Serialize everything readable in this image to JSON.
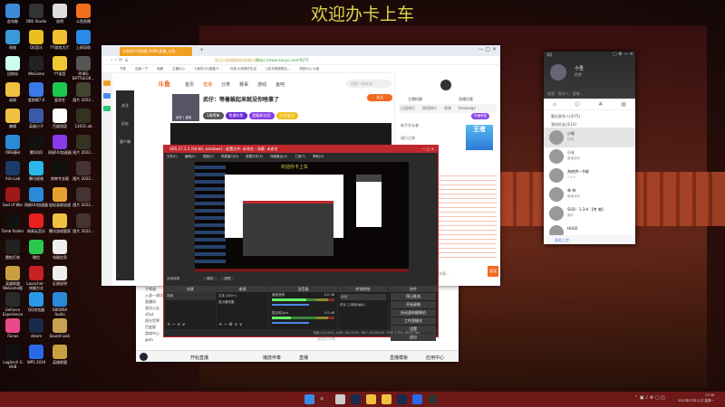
{
  "banner": "欢迎办卡上车",
  "desktop_icons": [
    {
      "label": "此电脑",
      "color": "#3a8ad8"
    },
    {
      "label": "OBS Studio",
      "color": "#333"
    },
    {
      "label": "说明",
      "color": "#ddd"
    },
    {
      "label": "斗鱼直播",
      "color": "#f07020"
    },
    {
      "label": "网络",
      "color": "#3a9ad8"
    },
    {
      "label": "QQ音乐",
      "color": "#e8c020"
    },
    {
      "label": "YY游戏大厅",
      "color": "#f0c030"
    },
    {
      "label": "上网导航",
      "color": "#2a8ae8"
    },
    {
      "label": "回收站",
      "color": "#cfe"
    },
    {
      "label": "WeGame",
      "color": "#222"
    },
    {
      "label": "YY语音",
      "color": "#f0c830"
    },
    {
      "label": "PUBG BATTLEGR...",
      "color": "#555"
    },
    {
      "label": "成绩",
      "color": "#f0c040"
    },
    {
      "label": "爱剪辑7.0",
      "color": "#3a7ae8"
    },
    {
      "label": "爱奇艺",
      "color": "#1ac850"
    },
    {
      "label": "图片 2022...",
      "color": "#443"
    },
    {
      "label": "编辑",
      "color": "#f0c040"
    },
    {
      "label": "英雄小子",
      "color": "#3a5aa8"
    },
    {
      "label": "百度网盘",
      "color": "#fff"
    },
    {
      "label": "13031.ab",
      "color": "#332"
    },
    {
      "label": "OBS源码",
      "color": "#2a8ad8"
    },
    {
      "label": "腾讯QQ",
      "color": "#111"
    },
    {
      "label": "网易UU加速器",
      "color": "#8a3ae8"
    },
    {
      "label": "图片 2022...",
      "color": "#332"
    },
    {
      "label": "Aim Lab",
      "color": "#1a3a6a"
    },
    {
      "label": "腾讯视频",
      "color": "#2ab8e8"
    },
    {
      "label": "剪映专业版",
      "color": "#111"
    },
    {
      "label": "图片 2022...",
      "color": "#433"
    },
    {
      "label": "God of War",
      "color": "#a01818"
    },
    {
      "label": "网易UU加速器",
      "color": "#2a8ad8"
    },
    {
      "label": "轻松录屏加速",
      "color": "#e8a030"
    },
    {
      "label": "图片 2022...",
      "color": "#433"
    },
    {
      "label": "Tomb Raider",
      "color": "#111"
    },
    {
      "label": "网易云音乐",
      "color": "#e82020"
    },
    {
      "label": "腾讯游戏管家",
      "color": "#f0c040"
    },
    {
      "label": "图片 2022...",
      "color": "#433"
    },
    {
      "label": "雷蛇灯效",
      "color": "#222"
    },
    {
      "label": "微信",
      "color": "#2ac850"
    },
    {
      "label": "电脑信息",
      "color": "#eee"
    },
    {
      "label": "",
      "color": "transparent"
    },
    {
      "label": "英雄联盟 WeGame版",
      "color": "#c8a040"
    },
    {
      "label": "Launcher - 快捷方式",
      "color": "#c82020"
    },
    {
      "label": "反馈说明",
      "color": "#eee"
    },
    {
      "label": "",
      "color": "transparent"
    },
    {
      "label": "GeForce Experience",
      "color": "#2a2a2a"
    },
    {
      "label": "QQ浏览器",
      "color": "#2a9ae8"
    },
    {
      "label": "XBOXRA Audio",
      "color": "#2a8ad8"
    },
    {
      "label": "",
      "color": "transparent"
    },
    {
      "label": "iTunes",
      "color": "#e84a8a"
    },
    {
      "label": "steam",
      "color": "#1a2a4a"
    },
    {
      "label": "Sound Lock",
      "color": "#c8a050"
    },
    {
      "label": "",
      "color": "transparent"
    },
    {
      "label": "Logitech G HUB",
      "color": "#111"
    },
    {
      "label": "WPS 2019",
      "color": "#2a6ae8"
    },
    {
      "label": "英雄联盟",
      "color": "#c8a040"
    },
    {
      "label": "",
      "color": "transparent"
    }
  ],
  "browser": {
    "tab": "斗鱼的小Q直播_PUBG直播_斗鱼...",
    "url": "https://www.douyu.com/9271",
    "site_name": "武汉斗鱼网络科技有限公司",
    "bookmarks": [
      "书签",
      "百度一下",
      "收藏",
      "主播中心",
      "斗鱼的小Q直播 P...",
      "抖音-记录美好生活",
      "[]京东超值购买...",
      "领奖中心-斗鱼"
    ],
    "nav": [
      "首页",
      "直播",
      "分类",
      "赛事",
      "游戏",
      "鱼吧"
    ],
    "search_placeholder": "搜索一档吃鸡",
    "stream_title": "武仔：等着躲起来就没你啥事了",
    "streamer": "武仔 | 金枪",
    "follow": "关注",
    "badges": [
      "1周榜单",
      "鱼塘钓鱼",
      "超级粉丝团",
      "火力全开"
    ],
    "side_tabs": [
      "关注",
      "历史",
      "客户端"
    ],
    "right": {
      "links": [
        "主播招募",
        "直播回看"
      ],
      "tabs": [
        "日冠排行",
        "周冠排行",
        "贵宾",
        "fanbadge"
      ],
      "viewer1": "新手学长者",
      "viewer2": "道行之神",
      "btn": "开通贵族"
    },
    "chat_placeholder": "发送弹幕...",
    "send": "发送"
  },
  "yy": {
    "channels": [
      "子频道",
      "入选一测试",
      "直播间",
      "测试公告",
      "cfLst",
      "观光世界",
      "百变屋",
      "游戏中心",
      "gam"
    ],
    "input_placeholder": "说点什么吧...",
    "bottom": [
      "开始直播",
      "播放伴奏",
      "直播"
    ],
    "right_bottom": [
      "直播模板",
      "应用中心"
    ]
  },
  "obs": {
    "title": "OBS 27.2.3 (64-bit, windows) - 配置文件: 未命名 - 场景: 未命名",
    "menu": [
      "文件(F)",
      "编辑(E)",
      "视图(V)",
      "停靠窗口(D)",
      "配置文件(P)",
      "场景集合(S)",
      "工具(T)",
      "帮助(H)"
    ],
    "no_source": "未选择源",
    "props": "属性",
    "filters": "滤镜",
    "docks": [
      "场景",
      "来源",
      "混音器",
      "转场特效",
      "控件"
    ],
    "scene": "场景",
    "sources": [
      "文本 (GDI+)",
      "显示器采集"
    ],
    "mixer": [
      {
        "name": "桌面音频",
        "db": "0.0 dB",
        "level": 0.55
      },
      {
        "name": "麦克风/Aux",
        "db": "0.0 dB",
        "level": 0.3
      }
    ],
    "transition": "淡出",
    "duration_label": "时长",
    "duration": "300 ms",
    "controls": [
      "停止推流",
      "开始录制",
      "启动虚拟摄像机",
      "工作室模式",
      "设置",
      "退出"
    ],
    "status": {
      "live": "LIVE: 00:00:00",
      "rec": "REC: 00:00:00",
      "cpu": "CPU: 1.9%, 60.00 fps",
      "dropped": "丢帧 0 (0.0%)"
    }
  },
  "qq": {
    "name": "小圣",
    "signature": "抓梦",
    "search": "搜索：联系人、群聊...",
    "groups": [
      "最近联系人(4/75)",
      "我的好友(4/10)"
    ],
    "contacts": [
      {
        "name": "小瑶",
        "status": "在线"
      },
      {
        "name": "小光",
        "status": "营地战况"
      },
      {
        "name": "海底捞一节能",
        "status": "7 6 2"
      },
      {
        "name": "林 林",
        "status": "营地战况"
      },
      {
        "name": "SOD - 1-3-A 【考 笔】",
        "status": "离开"
      },
      {
        "name": "HUGE",
        "status": ""
      }
    ],
    "bottom_text": "粘贴上传"
  },
  "taskbar": {
    "time": "17:58",
    "date": "2022年07月11日 星期一"
  }
}
